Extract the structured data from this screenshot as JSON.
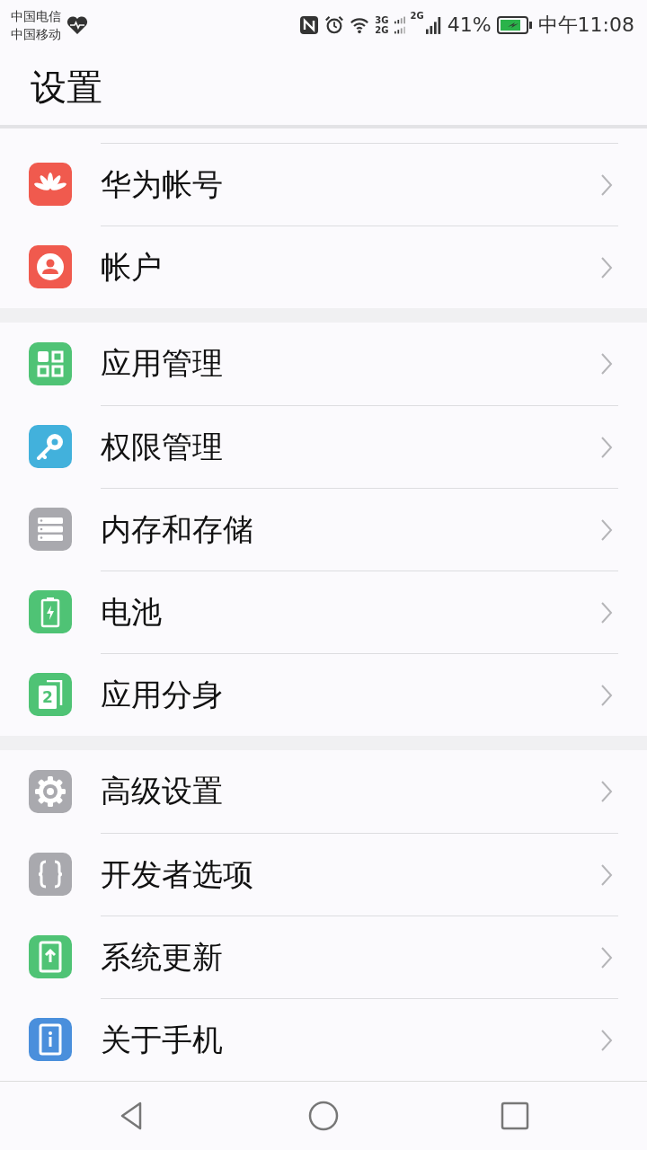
{
  "status_bar": {
    "carriers": [
      "中国电信",
      "中国移动"
    ],
    "network_1": "3G",
    "network_2": "2G",
    "network_3": "2G",
    "battery": "41%",
    "time": "中午11:08"
  },
  "title": "设置",
  "groups": [
    {
      "items": [
        {
          "label": "华为帐号",
          "kind": "flower",
          "color": "#f05a4e"
        },
        {
          "label": "帐户",
          "kind": "person",
          "color": "#f05a4e"
        }
      ]
    },
    {
      "items": [
        {
          "label": "应用管理",
          "kind": "grid",
          "color": "#4fc375"
        },
        {
          "label": "权限管理",
          "kind": "key",
          "color": "#42b1dc"
        },
        {
          "label": "内存和存储",
          "kind": "storage",
          "color": "#a9a9ae"
        },
        {
          "label": "电池",
          "kind": "battery",
          "color": "#4fc375"
        },
        {
          "label": "应用分身",
          "kind": "twin",
          "color": "#4fc375",
          "badge": "2"
        }
      ]
    },
    {
      "items": [
        {
          "label": "高级设置",
          "kind": "gear",
          "color": "#a9a9ae"
        },
        {
          "label": "开发者选项",
          "kind": "braces",
          "color": "#a9a9ae"
        },
        {
          "label": "系统更新",
          "kind": "update",
          "color": "#4fc375"
        },
        {
          "label": "关于手机",
          "kind": "info",
          "color": "#4a8fdc"
        }
      ]
    }
  ]
}
